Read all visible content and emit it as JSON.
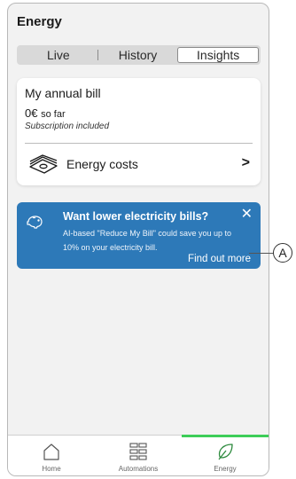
{
  "header": {
    "title": "Energy"
  },
  "tabs": [
    {
      "label": "Live",
      "active": false
    },
    {
      "label": "History",
      "active": false
    },
    {
      "label": "Insights",
      "active": true
    }
  ],
  "bill_card": {
    "title": "My annual bill",
    "amount": "0€",
    "amount_suffix": "so far",
    "subtitle": "Subscription included",
    "costs_label": "Energy costs",
    "costs_chevron": ">",
    "icon": "money-icon"
  },
  "promo": {
    "icon": "piggy-bank-icon",
    "title": "Want lower electricity bills?",
    "body": "AI-based \"Reduce My Bill\" could save you up to 10% on your electricity bill.",
    "close": "✕",
    "link": "Find out more",
    "background": "#2d79b8"
  },
  "callout": {
    "label": "A"
  },
  "bottom_nav": [
    {
      "label": "Home",
      "icon": "home-icon",
      "active": false
    },
    {
      "label": "Automations",
      "icon": "automations-grid-icon",
      "active": false
    },
    {
      "label": "Energy",
      "icon": "leaf-icon",
      "active": true
    }
  ],
  "colors": {
    "accent": "#3dcd58",
    "promo": "#2d79b8",
    "background": "#f2f2f2"
  }
}
